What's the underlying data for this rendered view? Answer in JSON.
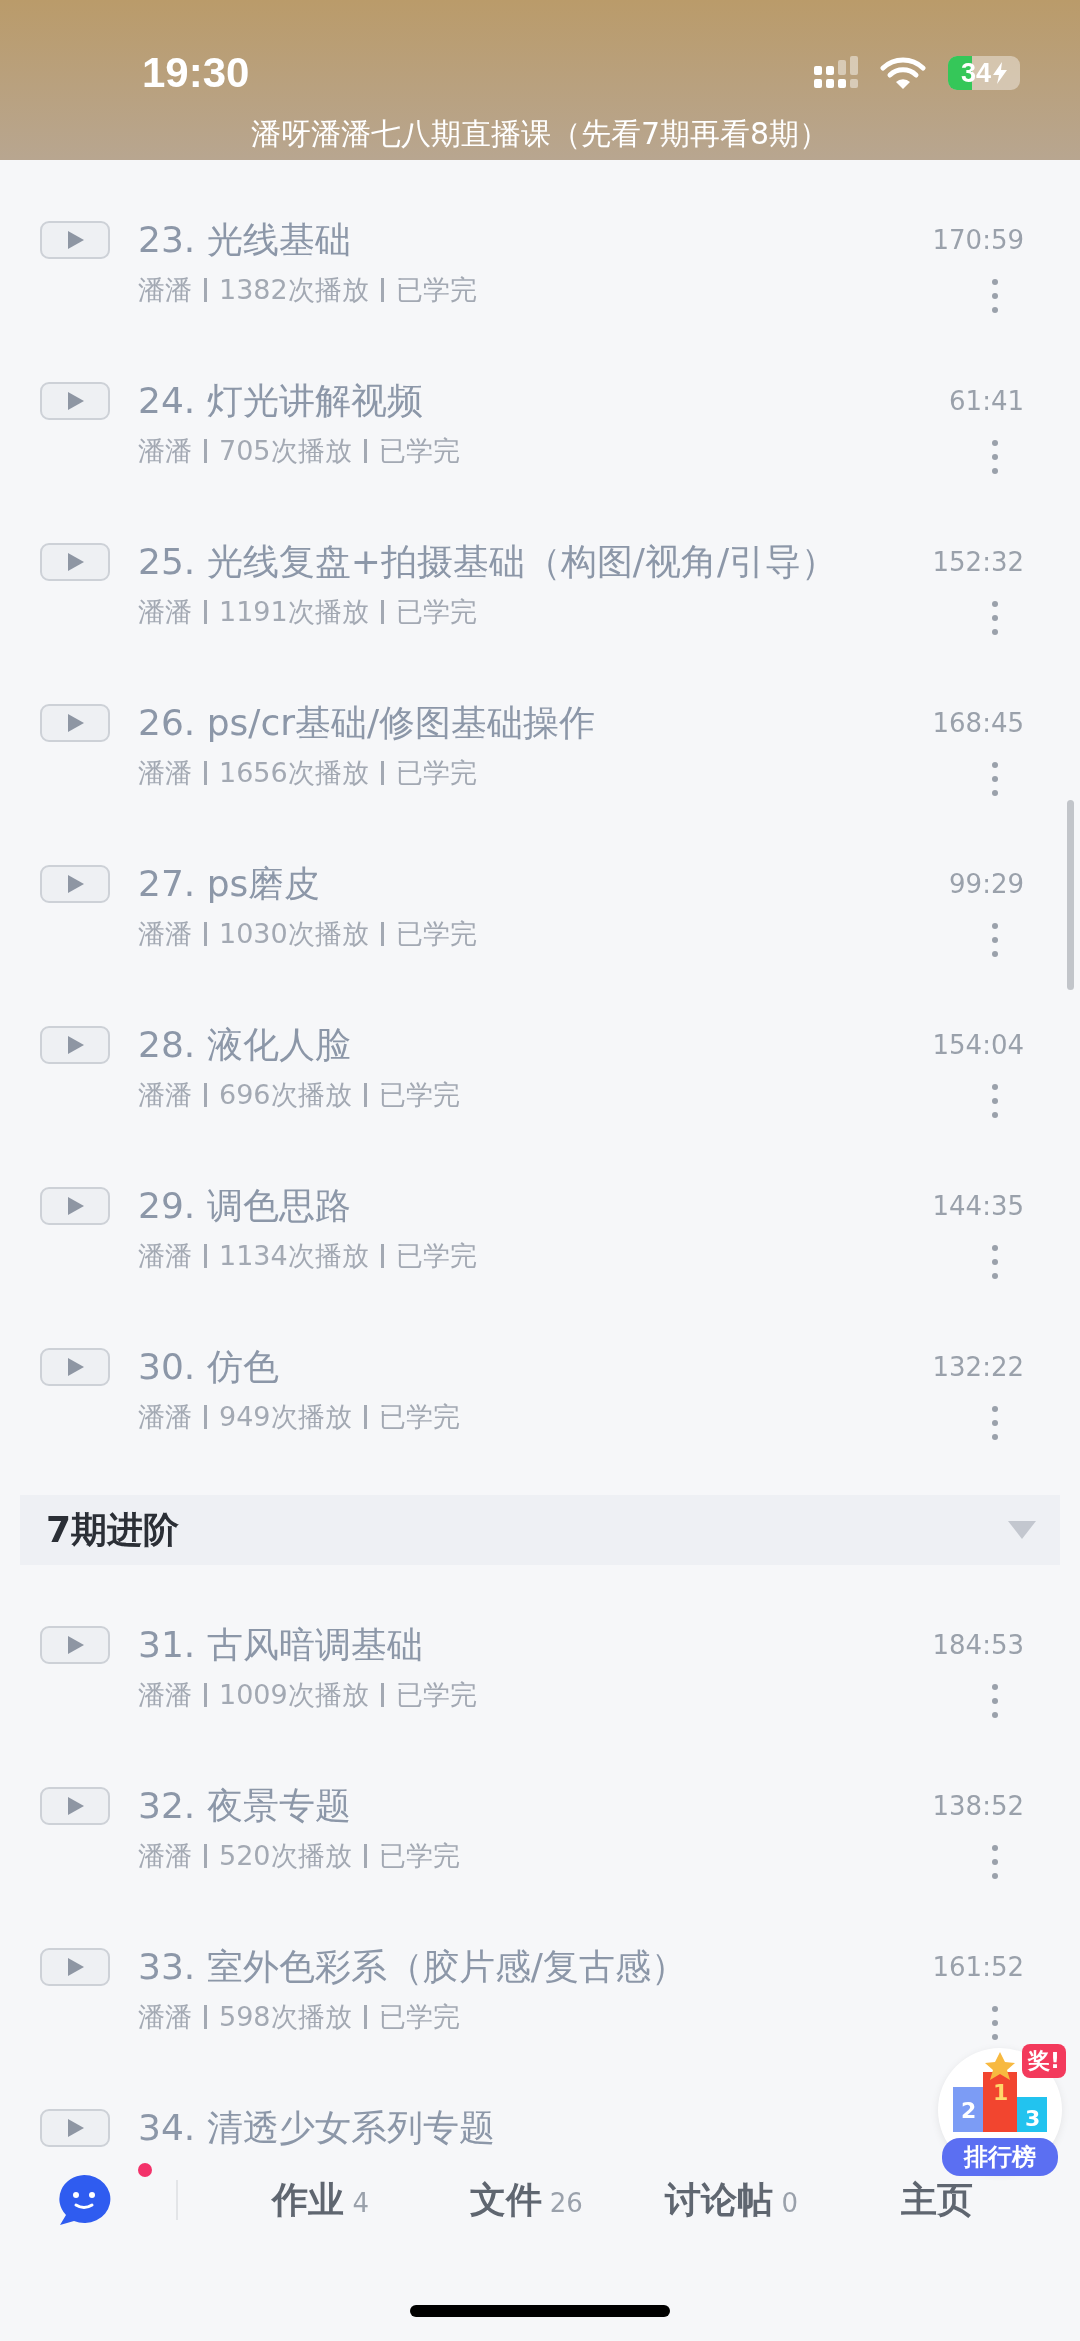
{
  "status_bar": {
    "time": "19:30",
    "battery": "34"
  },
  "header": {
    "title": "潘呀潘潘七八期直播课（先看7期再看8期）"
  },
  "sections": [
    {
      "kind": "plain",
      "lessons": [
        {
          "title": "23. 光线基础",
          "author": "潘潘",
          "plays": "1382次播放",
          "status": "已学完",
          "duration": "170:59"
        },
        {
          "title": "24. 灯光讲解视频",
          "author": "潘潘",
          "plays": "705次播放",
          "status": "已学完",
          "duration": "61:41"
        },
        {
          "title": "25. 光线复盘+拍摄基础（构图/视角/引导）",
          "author": "潘潘",
          "plays": "1191次播放",
          "status": "已学完",
          "duration": "152:32"
        },
        {
          "title": "26. ps/cr基础/修图基础操作",
          "author": "潘潘",
          "plays": "1656次播放",
          "status": "已学完",
          "duration": "168:45"
        },
        {
          "title": "27. ps磨皮",
          "author": "潘潘",
          "plays": "1030次播放",
          "status": "已学完",
          "duration": "99:29"
        },
        {
          "title": "28. 液化人脸",
          "author": "潘潘",
          "plays": "696次播放",
          "status": "已学完",
          "duration": "154:04"
        },
        {
          "title": "29. 调色思路",
          "author": "潘潘",
          "plays": "1134次播放",
          "status": "已学完",
          "duration": "144:35"
        },
        {
          "title": "30. 仿色",
          "author": "潘潘",
          "plays": "949次播放",
          "status": "已学完",
          "duration": "132:22"
        }
      ]
    },
    {
      "kind": "header",
      "title": "7期进阶",
      "expanded": true,
      "lessons": [
        {
          "title": "31. 古风暗调基础",
          "author": "潘潘",
          "plays": "1009次播放",
          "status": "已学完",
          "duration": "184:53"
        },
        {
          "title": "32. 夜景专题",
          "author": "潘潘",
          "plays": "520次播放",
          "status": "已学完",
          "duration": "138:52"
        },
        {
          "title": "33. 室外色彩系（胶片感/复古感）",
          "author": "潘潘",
          "plays": "598次播放",
          "status": "已学完",
          "duration": "161:52"
        },
        {
          "title": "34. 清透少女系列专题"
        }
      ]
    }
  ],
  "leaderboard": {
    "label": "排行榜",
    "prize": "奖!",
    "ranks": [
      "2",
      "1",
      "3"
    ]
  },
  "bottom_nav": {
    "chat_unread": true,
    "tabs": [
      {
        "label": "作业",
        "count": "4"
      },
      {
        "label": "文件",
        "count": "26"
      },
      {
        "label": "讨论帖",
        "count": "0"
      },
      {
        "label": "主页"
      }
    ]
  }
}
